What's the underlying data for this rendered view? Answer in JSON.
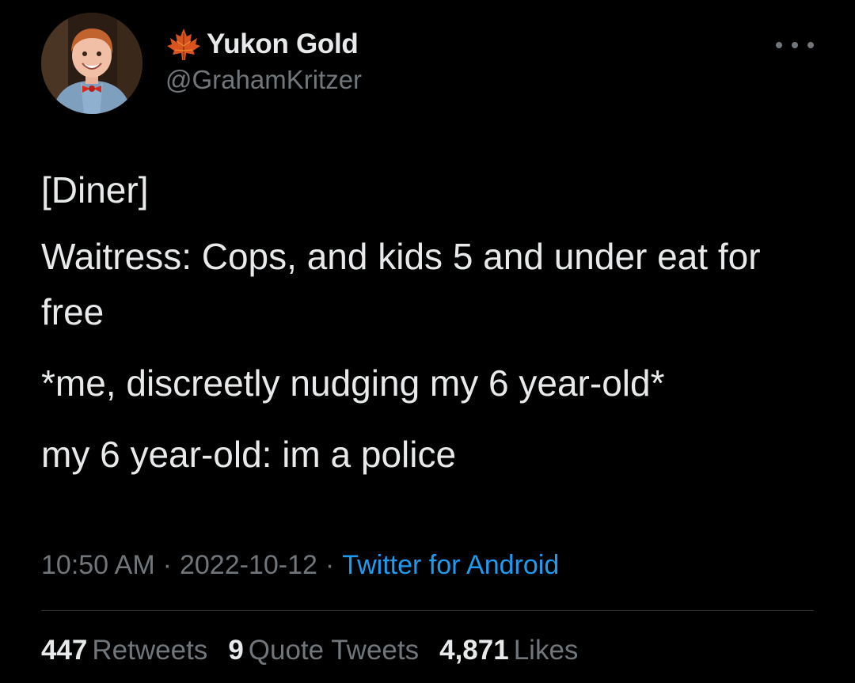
{
  "author": {
    "display_name": "Yukon Gold",
    "handle": "@GrahamKritzer",
    "name_emoji_icon": "maple-leaf-icon",
    "avatar_icon": "profile-photo-child-bowtie"
  },
  "tweet": {
    "paragraphs": [
      "[Diner]",
      "Waitress: Cops, and kids 5 and under eat for free",
      "*me, discreetly nudging my 6 year-old*",
      "my 6 year-old: im a police"
    ],
    "time": "10:50 AM",
    "separator": "·",
    "date": "2022-10-12",
    "source": "Twitter for Android"
  },
  "stats": {
    "retweets_count": "447",
    "retweets_label": "Retweets",
    "quotes_count": "9",
    "quotes_label": "Quote Tweets",
    "likes_count": "4,871",
    "likes_label": "Likes"
  },
  "colors": {
    "background": "#000000",
    "text": "#e7e9ea",
    "secondary": "#71767b",
    "link": "#1d9bf0",
    "divider": "#2f3336"
  }
}
